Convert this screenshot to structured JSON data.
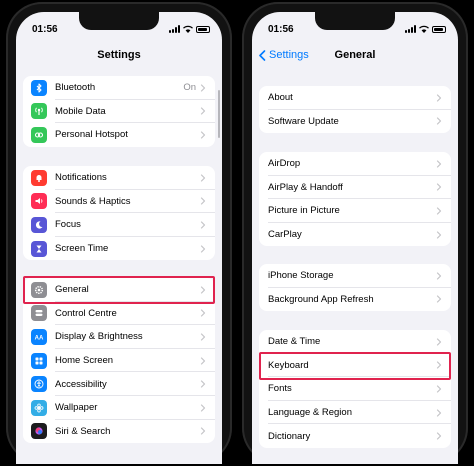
{
  "left": {
    "status": {
      "time": "01:56"
    },
    "nav": {
      "title": "Settings"
    },
    "groups": [
      [
        {
          "label": "Bluetooth",
          "value": "On",
          "icon": "bluetooth-icon",
          "color": "#0a84ff"
        },
        {
          "label": "Mobile Data",
          "value": "",
          "icon": "antenna-icon",
          "color": "#34c759"
        },
        {
          "label": "Personal Hotspot",
          "value": "",
          "icon": "hotspot-icon",
          "color": "#34c759"
        }
      ],
      [
        {
          "label": "Notifications",
          "value": "",
          "icon": "bell-icon",
          "color": "#ff3b30"
        },
        {
          "label": "Sounds & Haptics",
          "value": "",
          "icon": "speaker-icon",
          "color": "#ff2d55"
        },
        {
          "label": "Focus",
          "value": "",
          "icon": "moon-icon",
          "color": "#5856d6"
        },
        {
          "label": "Screen Time",
          "value": "",
          "icon": "hourglass-icon",
          "color": "#5856d6"
        }
      ],
      [
        {
          "label": "General",
          "value": "",
          "icon": "gear-icon",
          "color": "#8e8e93"
        },
        {
          "label": "Control Centre",
          "value": "",
          "icon": "toggles-icon",
          "color": "#8e8e93"
        },
        {
          "label": "Display & Brightness",
          "value": "",
          "icon": "aa-icon",
          "color": "#0a84ff"
        },
        {
          "label": "Home Screen",
          "value": "",
          "icon": "grid-icon",
          "color": "#0a84ff"
        },
        {
          "label": "Accessibility",
          "value": "",
          "icon": "accessibility-icon",
          "color": "#0a84ff"
        },
        {
          "label": "Wallpaper",
          "value": "",
          "icon": "flower-icon",
          "color": "#32ade6"
        },
        {
          "label": "Siri & Search",
          "value": "",
          "icon": "siri-icon",
          "color": "#1c1c1e"
        }
      ]
    ]
  },
  "right": {
    "status": {
      "time": "01:56"
    },
    "nav": {
      "title": "General",
      "back_label": "Settings"
    },
    "groups": [
      [
        {
          "label": "About"
        },
        {
          "label": "Software Update"
        }
      ],
      [
        {
          "label": "AirDrop"
        },
        {
          "label": "AirPlay & Handoff"
        },
        {
          "label": "Picture in Picture"
        },
        {
          "label": "CarPlay"
        }
      ],
      [
        {
          "label": "iPhone Storage"
        },
        {
          "label": "Background App Refresh"
        }
      ],
      [
        {
          "label": "Date & Time"
        },
        {
          "label": "Keyboard"
        },
        {
          "label": "Fonts"
        },
        {
          "label": "Language & Region"
        },
        {
          "label": "Dictionary"
        }
      ]
    ]
  },
  "colors": {
    "accent": "#007aff",
    "highlight": "#e0234e",
    "background": "#f2f2f7"
  }
}
